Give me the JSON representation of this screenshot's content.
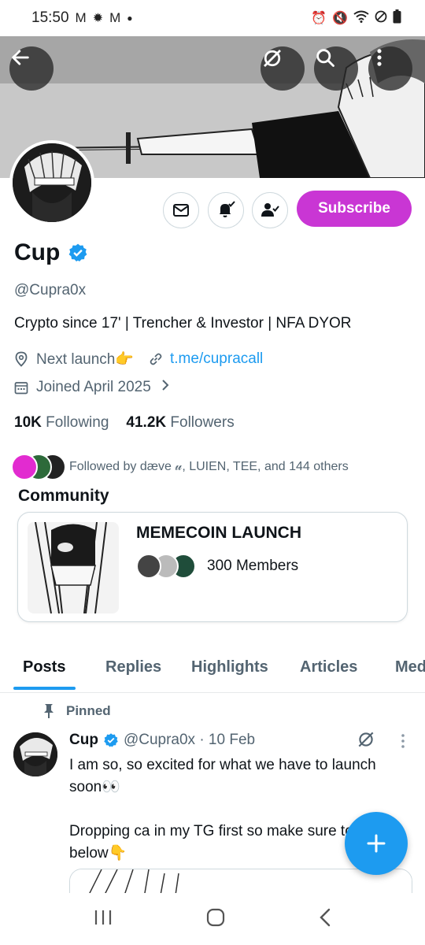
{
  "status_bar": {
    "time": "15:50",
    "left_icons": [
      "gmail-icon",
      "weather-sun-icon",
      "gmail-icon",
      "dot-icon"
    ],
    "right_icons": [
      "alarm-icon",
      "mute-icon",
      "wifi-icon",
      "no-sim-icon",
      "battery-icon"
    ]
  },
  "header": {
    "back_icon": "arrow-left-icon",
    "grok_icon": "grok-icon",
    "search_icon": "search-icon",
    "more_icon": "more-vertical-icon"
  },
  "profile": {
    "name": "Cup",
    "verified": true,
    "handle": "@Cupra0x",
    "bio": "Crypto since 17' | Trencher & Investor | NFA DYOR",
    "location": "Next launch👉",
    "website": "t.me/cupracall",
    "joined": "Joined April 2025",
    "following_count": "10K",
    "following_label": "Following",
    "followers_count": "41.2K",
    "followers_label": "Followers",
    "followed_by": "Followed by dæve 𝓊, LUIEN, TEE, and 144 others"
  },
  "actions": {
    "message_icon": "mail-icon",
    "notify_icon": "bell-check-icon",
    "follow_icon": "person-check-icon",
    "subscribe_label": "Subscribe"
  },
  "community": {
    "section_title": "Community",
    "name": "MEMECOIN LAUNCH",
    "members": "300 Members"
  },
  "tabs": [
    "Posts",
    "Replies",
    "Highlights",
    "Articles",
    "Media"
  ],
  "active_tab": "Posts",
  "post": {
    "pinned_label": "Pinned",
    "author": "Cup",
    "handle_time": "@Cupra0x · 10 Feb",
    "text": "I am so, so excited for what we have to launch soon👀\n\nDropping ca in my TG first so make sure to join below👇"
  },
  "colors": {
    "accent": "#1d9bf0",
    "subscribe": "#c936d4",
    "verified": "#1d9bf0"
  }
}
